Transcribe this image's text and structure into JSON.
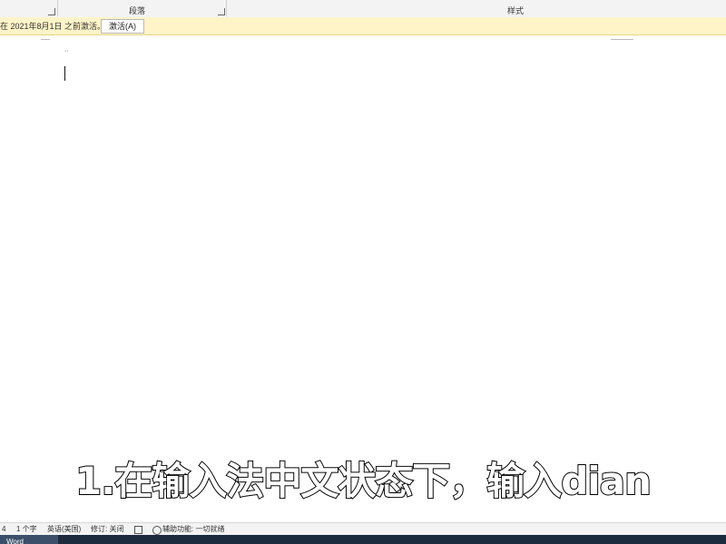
{
  "ribbon": {
    "groups": [
      {
        "name": "paragraph",
        "label": "段落"
      },
      {
        "name": "styles",
        "label": "样式"
      }
    ]
  },
  "activation": {
    "message": "在 2021年8月1日 之前激活。",
    "button_label": "激活(A)"
  },
  "document": {
    "paragraph_mark": "¨"
  },
  "caption": {
    "text": "1.在输入法中文状态下，输入dian"
  },
  "status_bar": {
    "page": "4",
    "word_count": "1 个字",
    "language": "英语(美国)",
    "track_changes": "修订: 关闭",
    "accessibility": "辅助功能: 一切就绪"
  },
  "taskbar": {
    "app_label": "Word"
  }
}
